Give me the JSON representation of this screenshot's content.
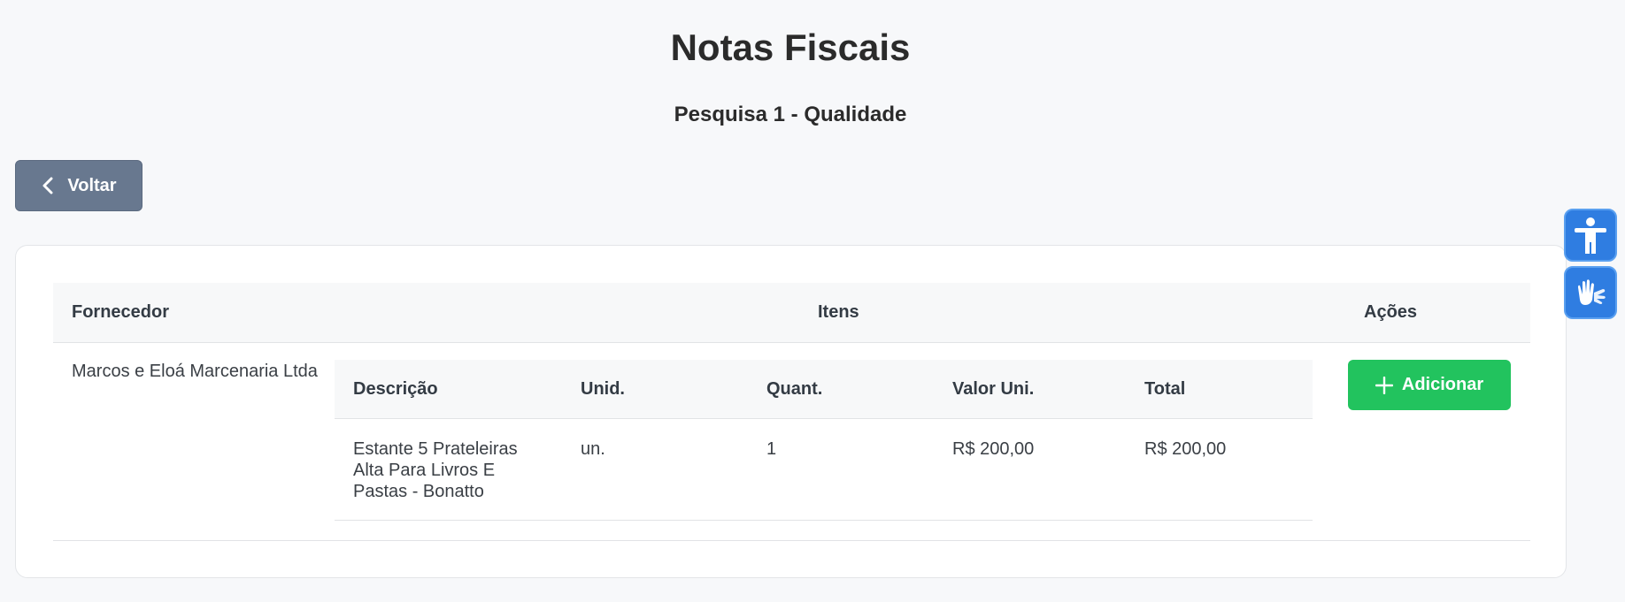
{
  "header": {
    "title": "Notas Fiscais",
    "subtitle": "Pesquisa 1 - Qualidade"
  },
  "back_button": {
    "label": "Voltar",
    "icon": "chevron-left-icon"
  },
  "table": {
    "columns": {
      "supplier": "Fornecedor",
      "items": "Itens",
      "actions": "Ações"
    },
    "rows": [
      {
        "supplier": "Marcos e Eloá Marcenaria Ltda",
        "items": {
          "columns": {
            "description": "Descrição",
            "unit": "Unid.",
            "quantity": "Quant.",
            "unit_price": "Valor Uni.",
            "total": "Total"
          },
          "rows": [
            {
              "description": "Estante 5 Prateleiras Alta Para Livros E Pastas - Bonatto",
              "unit": "un.",
              "quantity": "1",
              "unit_price": "R$ 200,00",
              "total": "R$ 200,00"
            }
          ]
        },
        "action": {
          "label": "Adicionar",
          "icon": "plus-icon"
        }
      }
    ]
  },
  "accessibility": {
    "buttons": [
      {
        "icon": "accessibility-person-icon"
      },
      {
        "icon": "sign-language-hands-icon"
      }
    ]
  },
  "colors": {
    "back_button": "#68788f",
    "add_button": "#22c35e",
    "accessibility": "#2f7de1"
  }
}
